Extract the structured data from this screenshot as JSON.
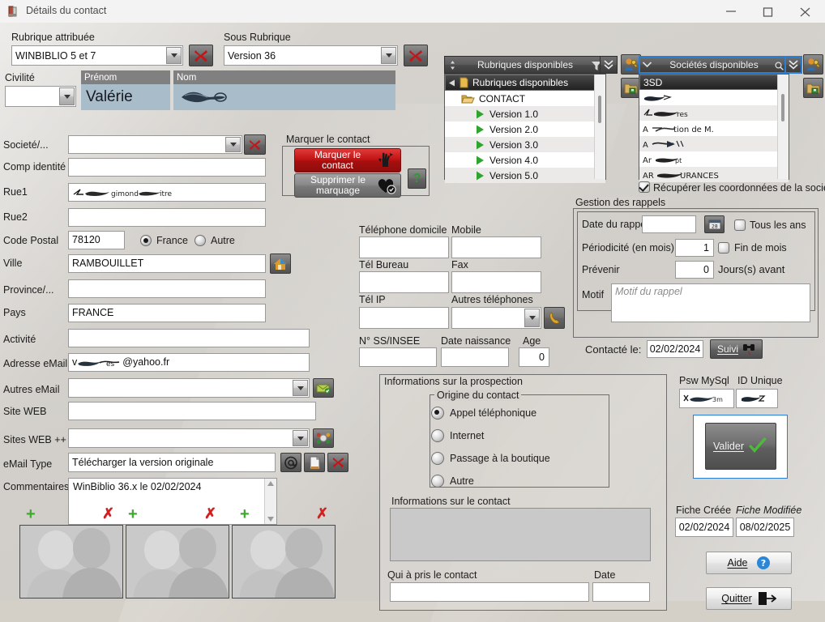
{
  "window": {
    "title": "Détails du contact",
    "minimize_label": "Minimize",
    "maximize_label": "Maximize",
    "close_label": "Close"
  },
  "top": {
    "rubrique_label": "Rubrique attribuée",
    "rubrique_value": "WINBIBLIO 5 et 7",
    "sous_rubrique_label": "Sous Rubrique",
    "sous_rubrique_value": "Version 36",
    "civilite_label": "Civilité",
    "civilite_value": "",
    "prenom_header": "Prénom",
    "prenom_value": "Valérie",
    "nom_header": "Nom",
    "nom_value": ""
  },
  "identity": {
    "societe_label": "Societé/...",
    "societe_value": "",
    "comp_identite_label": "Comp identité",
    "comp_identite_value": "",
    "rue1_label": "Rue1",
    "rue1_value": "",
    "rue2_label": "Rue2",
    "rue2_value": "",
    "code_postal_label": "Code Postal",
    "code_postal_value": "78120",
    "france_label": "France",
    "autre_label": "Autre",
    "ville_label": "Ville",
    "ville_value": "RAMBOUILLET",
    "province_label": "Province/...",
    "province_value": "",
    "pays_label": "Pays",
    "pays_value": "FRANCE",
    "activite_label": "Activité",
    "activite_value": "",
    "adresse_email_label": "Adresse eMail",
    "adresse_email_suffix": "@yahoo.fr",
    "autres_email_label": "Autres eMail",
    "autres_email_value": "",
    "site_web_label": "Site WEB",
    "site_web_value": "",
    "sites_web_pp_label": "Sites WEB ++",
    "sites_web_pp_value": "",
    "email_type_label": "eMail Type",
    "email_type_value": "Télécharger la version originale",
    "commentaires_label": "Commentaires",
    "commentaires_value": "WinBiblio 36.x le 02/02/2024"
  },
  "marquer": {
    "group_label": "Marquer le contact",
    "mark_button": "Marquer le contact",
    "unmark_button": "Supprimer le marquage",
    "help_label": "?"
  },
  "phones": {
    "tel_domicile_label": "Téléphone domicile",
    "tel_domicile_value": "",
    "mobile_label": "Mobile",
    "mobile_value": "",
    "tel_bureau_label": "Tél Bureau",
    "tel_bureau_value": "",
    "fax_label": "Fax",
    "fax_value": "",
    "tel_ip_label": "Tél IP",
    "tel_ip_value": "",
    "autres_tel_label": "Autres téléphones",
    "autres_tel_value": "",
    "ss_insee_label": "N° SS/INSEE",
    "ss_insee_value": "",
    "date_naissance_label": "Date naissance",
    "date_naissance_value": "",
    "age_label": "Age",
    "age_value": "0"
  },
  "trees": {
    "rubriques": {
      "header": "Rubriques disponibles",
      "root": "Rubriques disponibles",
      "parent": "CONTACT",
      "items": [
        "Version 1.0",
        "Version 2.0",
        "Version 3.0",
        "Version 4.0",
        "Version 5.0"
      ]
    },
    "societes": {
      "header": "Sociétés disponibles",
      "items": [
        "3SD",
        "",
        "res",
        "tion de M.",
        "",
        "Ar",
        "URANCES"
      ],
      "item_partials": [
        "3SD",
        "",
        "res",
        "tion de M.",
        "",
        "Ar",
        "URANCES"
      ],
      "checkbox_label": "Récupérer les coordonnées de la société",
      "checkbox_checked": true
    }
  },
  "rappels": {
    "group_label": "Gestion des rappels",
    "date_rappel_label": "Date du rappel",
    "date_rappel_value": "",
    "tous_les_ans_label": "Tous les ans",
    "periodicite_label": "Périodicité (en mois)",
    "periodicite_value": "1",
    "fin_de_mois_label": "Fin de mois",
    "prevenir_label": "Prévenir",
    "prevenir_value": "0",
    "jours_avant_label": "Jours(s) avant",
    "motif_label": "Motif",
    "motif_placeholder": "Motif du rappel",
    "motif_value": "",
    "contacte_le_label": "Contacté le:",
    "contacte_le_value": "02/02/2024",
    "suivi_button": "Suivi"
  },
  "prospection": {
    "group_label": "Informations sur la prospection",
    "origine_label": "Origine du contact",
    "origine_options": [
      "Appel téléphonique",
      "Internet",
      "Passage à la boutique",
      "Autre"
    ],
    "origine_selected_index": 0,
    "infos_contact_label": "Informations sur le contact",
    "infos_contact_value": "",
    "qui_label": "Qui à pris le contact",
    "qui_value": "",
    "date_label": "Date",
    "date_value": ""
  },
  "right": {
    "psw_mysql_label": "Psw MySql",
    "id_unique_label": "ID Unique",
    "valider_button": "Valider",
    "fiche_creee_label": "Fiche Créée",
    "fiche_creee_value": "02/02/2024",
    "fiche_modifiee_label": "Fiche Modifiée",
    "fiche_modifiee_value": "08/02/2025",
    "aide_button": "Aide",
    "quitter_button": "Quitter"
  },
  "photos": {
    "add_label": "+",
    "delete_label": "✗",
    "count": 3
  },
  "colors": {
    "accent_blue": "#2a7fd4",
    "mark_red": "#c01a1a",
    "green": "#3eaa2e",
    "red": "#d02020",
    "header_gray": "#808080",
    "field_blue": "#a9bcca"
  }
}
